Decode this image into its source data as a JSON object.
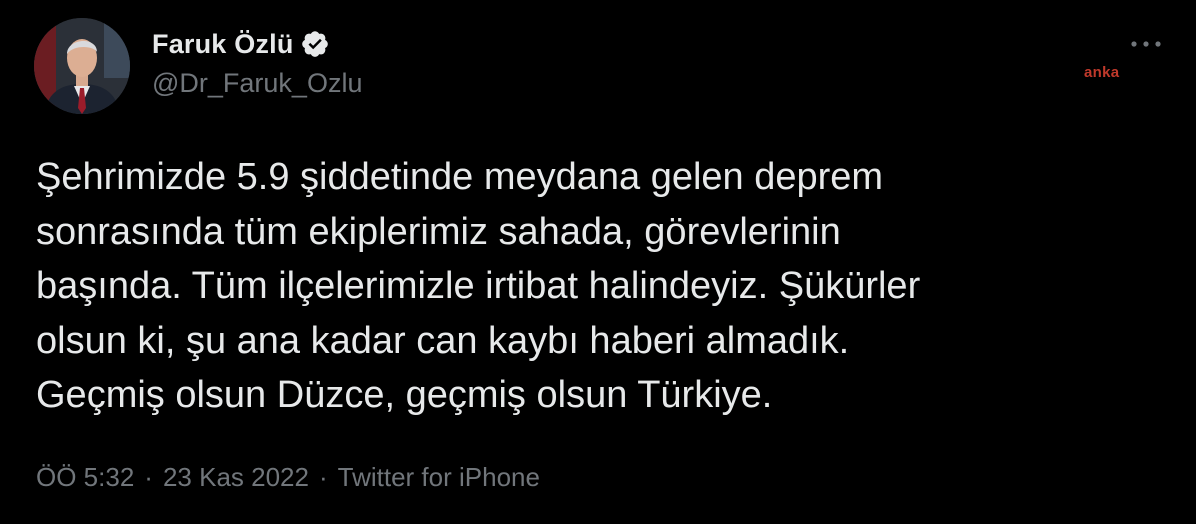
{
  "author": {
    "display_name": "Faruk Özlü",
    "handle": "@Dr_Faruk_Ozlu",
    "verified": true,
    "avatar_icon": "profile-photo"
  },
  "watermark": "anka",
  "tweet": {
    "text": "Şehrimizde 5.9 şiddetinde meydana gelen deprem\nsonrasında tüm ekiplerimiz sahada, görevlerinin\nbaşında. Tüm ilçelerimizle irtibat halindeyiz. Şükürler\nolsun ki, şu ana kadar can kaybı haberi almadık.\nGeçmiş olsun Düzce, geçmiş olsun Türkiye."
  },
  "meta": {
    "time": "ÖÖ 5:32",
    "date": "23 Kas 2022",
    "source": "Twitter for iPhone",
    "separator": "·"
  },
  "colors": {
    "background": "#000000",
    "primary_text": "#e7e9ea",
    "secondary_text": "#71767b",
    "watermark": "#c0392b"
  },
  "icons": {
    "verified": "verified-badge-icon",
    "more": "more-dots-icon"
  }
}
